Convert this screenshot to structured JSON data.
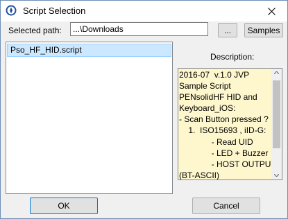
{
  "window": {
    "title": "Script Selection"
  },
  "path": {
    "label": "Selected path:",
    "value": "...\\Downloads",
    "browse_label": "...",
    "samples_label": "Samples"
  },
  "scripts": {
    "items": [
      "Pso_HF_HID.script"
    ],
    "selected": "Pso_HF_HID.script"
  },
  "description": {
    "label": "Description:",
    "text": "2016-07  v.1.0 JVP\nSample Script\nPENsolidHF HID and\nKeyboard_iOS:\n- Scan Button pressed ?\n    1.  ISO15693 , iID-G:\n              - Read UID\n              - LED + Buzzer\n              - HOST OUTPUT\n(BT-ASCII)"
  },
  "buttons": {
    "ok_label": "OK",
    "cancel_label": "Cancel"
  },
  "colors": {
    "selection_bg": "#cce8ff",
    "description_bg": "#fef7cd",
    "accent": "#0078d7"
  },
  "icons": {
    "app": "app-logo-icon",
    "close": "close-icon",
    "scroll_up": "scroll-up-arrow-icon",
    "scroll_down": "scroll-down-arrow-icon"
  }
}
